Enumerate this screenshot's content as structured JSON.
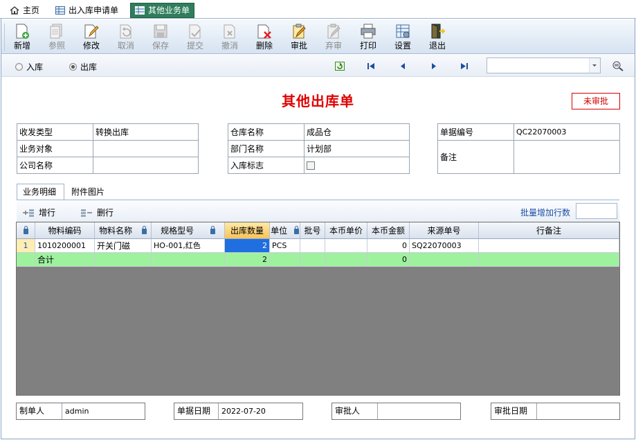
{
  "tabs": [
    {
      "label": "主页",
      "icon": "home-icon"
    },
    {
      "label": "出入库申请单",
      "icon": "grid-icon"
    },
    {
      "label": "其他业务单",
      "icon": "grid-icon"
    }
  ],
  "toolbar": {
    "add": "新增",
    "reference": "参照",
    "edit": "修改",
    "cancel": "取消",
    "save": "保存",
    "submit": "提交",
    "withdraw": "撤消",
    "delete": "删除",
    "approve": "审批",
    "reject": "弃审",
    "print": "打印",
    "settings": "设置",
    "exit": "退出"
  },
  "direction": {
    "in_label": "入库",
    "out_label": "出库",
    "selected": "out"
  },
  "search": {
    "value": ""
  },
  "form": {
    "title": "其他出库单",
    "status": "未审批",
    "send_type_label": "收发类型",
    "send_type_value": "转换出库",
    "business_target_label": "业务对象",
    "business_target_value": "",
    "company_label": "公司名称",
    "company_value": "",
    "warehouse_label": "仓库名称",
    "warehouse_value": "成品仓",
    "department_label": "部门名称",
    "department_value": "计划部",
    "inbound_flag_label": "入库标志",
    "doc_no_label": "单据编号",
    "doc_no_value": "QC22070003",
    "remark_label": "备注",
    "remark_value": ""
  },
  "detail_tabs": {
    "detail": "业务明细",
    "attachments": "附件图片"
  },
  "grid_toolbar": {
    "add_row": "增行",
    "delete_row": "删行",
    "batch_add_label": "批量增加行数",
    "batch_add_value": ""
  },
  "grid": {
    "columns": [
      "物料编码",
      "物料名称",
      "规格型号",
      "出库数量",
      "单位",
      "批号",
      "本币单价",
      "本币金额",
      "来源单号",
      "行备注"
    ],
    "rows": [
      {
        "index": "1",
        "code": "1010200001",
        "name": "开关门磁",
        "spec": "HO-001,红色",
        "qty": "2",
        "unit": "PCS",
        "batch": "",
        "price": "",
        "amount": "0",
        "source": "SQ22070003",
        "remark": ""
      }
    ],
    "total": {
      "label": "合计",
      "qty": "2",
      "amount": "0"
    }
  },
  "footer": {
    "maker_label": "制单人",
    "maker_value": "admin",
    "date_label": "单据日期",
    "date_value": "2022-07-20",
    "approver_label": "审批人",
    "approver_value": "",
    "approve_date_label": "审批日期",
    "approve_date_value": ""
  }
}
